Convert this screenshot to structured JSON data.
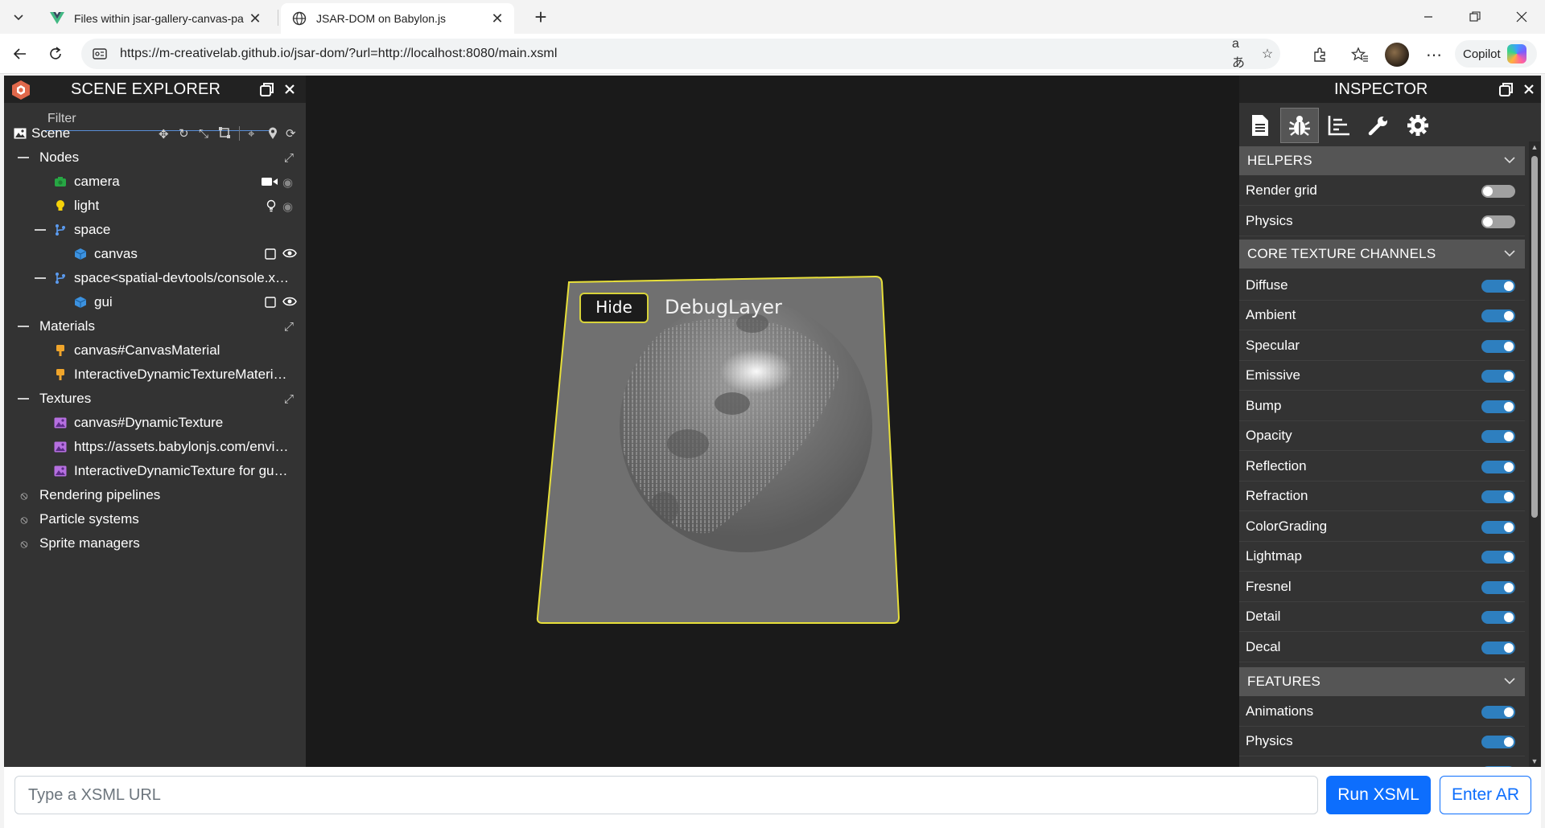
{
  "browser": {
    "tabs": [
      {
        "title": "Files within jsar-gallery-canvas-pa",
        "favicon": "vue-logo-icon",
        "active": false
      },
      {
        "title": "JSAR-DOM on Babylon.js",
        "favicon": "globe-icon",
        "active": true
      }
    ],
    "url": "https://m-creativelab.github.io/jsar-dom/?url=http://localhost:8080/main.xsml",
    "copilot_label": "Copilot"
  },
  "explorer": {
    "title": "SCENE EXPLORER",
    "filter_placeholder": "Filter",
    "scene_label": "Scene",
    "nodes_label": "Nodes",
    "nodes": {
      "camera": "camera",
      "light": "light",
      "space": "space",
      "canvas": "canvas",
      "space2": "space<spatial-devtools/console.x…",
      "gui": "gui"
    },
    "materials_label": "Materials",
    "materials": [
      "canvas#CanvasMaterial",
      "InteractiveDynamicTextureMateri…"
    ],
    "textures_label": "Textures",
    "textures": [
      "canvas#DynamicTexture",
      "https://assets.babylonjs.com/envi…",
      "InteractiveDynamicTexture for gu…"
    ],
    "disabled_groups": [
      "Rendering pipelines",
      "Particle systems",
      "Sprite managers"
    ]
  },
  "viewport": {
    "hide_button": "Hide",
    "panel_title": "DebugLayer"
  },
  "inspector": {
    "title": "INSPECTOR",
    "helpers_title": "HELPERS",
    "helpers": [
      {
        "label": "Render grid",
        "on": false
      },
      {
        "label": "Physics",
        "on": false
      }
    ],
    "channels_title": "CORE TEXTURE CHANNELS",
    "channels": [
      {
        "label": "Diffuse",
        "on": true
      },
      {
        "label": "Ambient",
        "on": true
      },
      {
        "label": "Specular",
        "on": true
      },
      {
        "label": "Emissive",
        "on": true
      },
      {
        "label": "Bump",
        "on": true
      },
      {
        "label": "Opacity",
        "on": true
      },
      {
        "label": "Reflection",
        "on": true
      },
      {
        "label": "Refraction",
        "on": true
      },
      {
        "label": "ColorGrading",
        "on": true
      },
      {
        "label": "Lightmap",
        "on": true
      },
      {
        "label": "Fresnel",
        "on": true
      },
      {
        "label": "Detail",
        "on": true
      },
      {
        "label": "Decal",
        "on": true
      }
    ],
    "features_title": "FEATURES",
    "features": [
      {
        "label": "Animations",
        "on": true
      },
      {
        "label": "Physics",
        "on": true
      }
    ]
  },
  "bottom": {
    "url_placeholder": "Type a XSML URL",
    "run_label": "Run XSML",
    "ar_label": "Enter AR"
  },
  "colors": {
    "panel_bg": "#333333",
    "header_bg": "#222222",
    "section_bg": "#555555",
    "toggle_on": "#2e7fbf",
    "primary": "#0d6efd",
    "panel_outline": "#e8e03a"
  }
}
